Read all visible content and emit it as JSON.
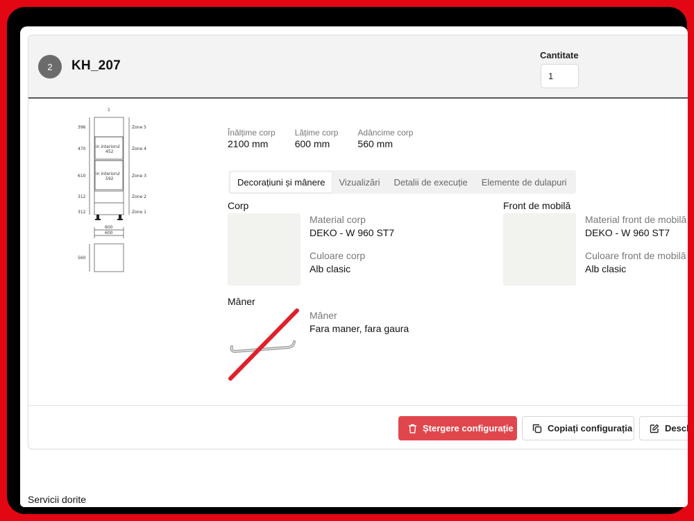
{
  "header": {
    "step_number": "2",
    "cabinet_code": "KH_207",
    "quantity_label": "Cantitate",
    "quantity_value": "1"
  },
  "drawing": {
    "top_label": "1",
    "heights": [
      "396",
      "470",
      "610",
      "312",
      "312"
    ],
    "zones": [
      "Zone 5",
      "Zone 4",
      "Zone 3",
      "Zone 2",
      "Zone 1"
    ],
    "interior_1_label": "in interiorul",
    "interior_1_value": "452",
    "interior_2_label": "in interiorul",
    "interior_2_value": "592",
    "width_outer": "600",
    "width_inner": "600",
    "depth": "560"
  },
  "dimensions": [
    {
      "label": "Înălțime corp",
      "value": "2100 mm"
    },
    {
      "label": "Lățime corp",
      "value": "600 mm"
    },
    {
      "label": "Adâncime corp",
      "value": "560 mm"
    }
  ],
  "tabs": [
    {
      "label": "Decorațiuni și mânere",
      "active": true
    },
    {
      "label": "Vizualizări",
      "active": false
    },
    {
      "label": "Detalii de execuție",
      "active": false
    },
    {
      "label": "Elemente de dulapuri",
      "active": false
    }
  ],
  "corp": {
    "title": "Corp",
    "material_label": "Material corp",
    "material_value": "DEKO - W 960 ST7",
    "color_label": "Culoare corp",
    "color_value": "Alb clasic",
    "swatch_color": "#f2f2ee"
  },
  "front": {
    "title": "Front de mobilă",
    "material_label": "Material front de mobilă",
    "material_value": "DEKO - W 960 ST7",
    "color_label": "Culoare front de mobilă",
    "color_value": "Alb clasic",
    "swatch_color": "#f2f2ee"
  },
  "handle": {
    "title": "Mâner",
    "label": "Mâner",
    "value": "Fara maner, fara gaura"
  },
  "actions": {
    "delete_label": "Ștergere configurație",
    "copy_label": "Copiați configurația",
    "desc_label": "Desch"
  },
  "services_label": "Servicii dorite",
  "colors": {
    "frame": "#e30613",
    "delete_button": "#e0474d",
    "strike": "#e0202b"
  }
}
